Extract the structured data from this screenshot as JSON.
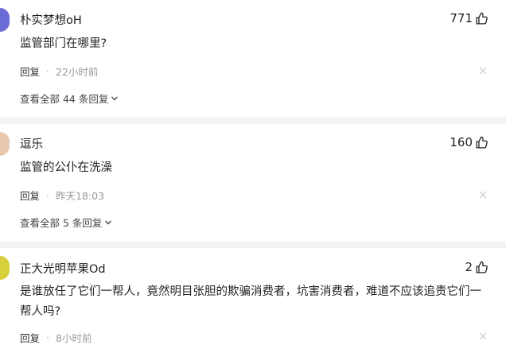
{
  "comments": [
    {
      "username": "朴实梦想oH",
      "likes": "771",
      "text": "监管部门在哪里?",
      "reply_label": "回复",
      "time": "22小时前",
      "view_replies": "查看全部 44 条回复"
    },
    {
      "username": "逗乐",
      "likes": "160",
      "text": "监管的公仆在洗澡",
      "reply_label": "回复",
      "time": "昨天18:03",
      "view_replies": "查看全部 5 条回复"
    },
    {
      "username": "正大光明苹果Od",
      "likes": "2",
      "text": "是谁放任了它们一帮人，竟然明目张胆的欺骗消费者，坑害消费者，难道不应该追责它们一帮人吗?",
      "reply_label": "回复",
      "time": "8小时前"
    }
  ],
  "colors": {
    "avatar1": "#6b6bd6",
    "avatar2": "#e8c9b0",
    "avatar3": "#d8d03a"
  },
  "icons": {
    "like": "thumbs-up-icon",
    "close": "close-icon",
    "expand": "chevron-down-icon"
  }
}
